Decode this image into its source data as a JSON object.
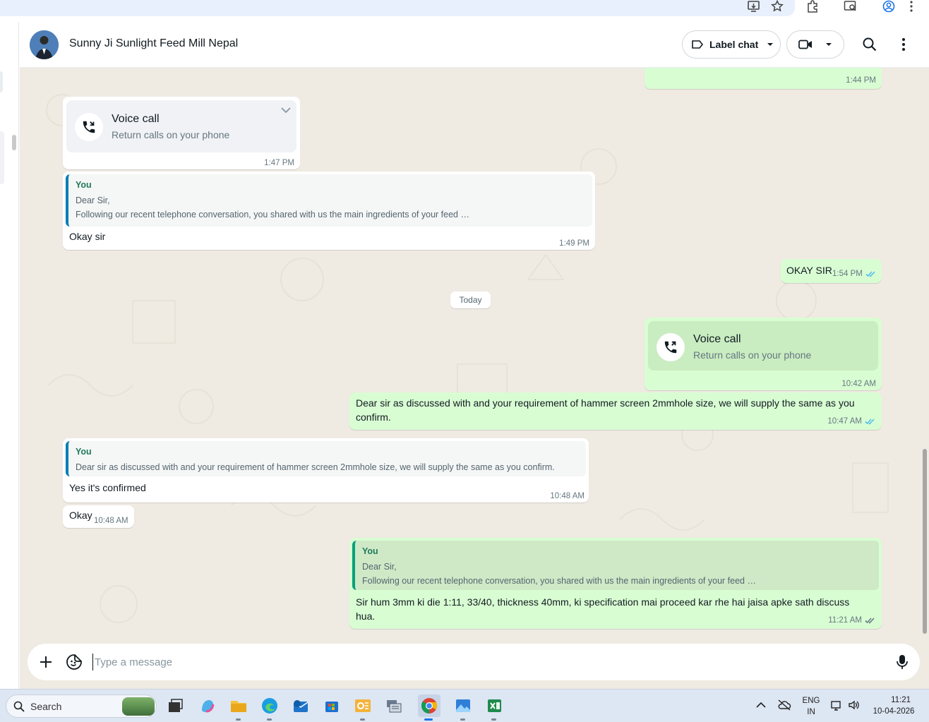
{
  "header": {
    "contact_name": "Sunny Ji Sunlight Feed Mill Nepal",
    "label_chat": "Label chat"
  },
  "messages": {
    "m0_time": "1:44 PM",
    "m1": {
      "title": "Voice call",
      "subtitle": "Return calls on your phone",
      "time": "1:47 PM"
    },
    "m2": {
      "quote_author": "You",
      "quote_line1": "Dear Sir,",
      "quote_line2": "Following our recent telephone conversation, you  shared with us the main ingredients of your feed …",
      "text": "Okay sir",
      "time": "1:49 PM"
    },
    "m3": {
      "text": "OKAY SIR",
      "time": "1:54 PM"
    },
    "date_divider": "Today",
    "m4": {
      "title": "Voice call",
      "subtitle": "Return calls on your phone",
      "time": "10:42 AM"
    },
    "m5": {
      "text_line1": "Dear sir as discussed with and your requirement of hammer screen 2mmhole size, we will supply the same as you",
      "text_line2": "confirm.",
      "time": "10:47 AM"
    },
    "m6": {
      "quote_author": "You",
      "quote_line1": "Dear sir as discussed with and your requirement of hammer screen 2mmhole size, we will supply the same as you confirm.",
      "text": "Yes it's confirmed",
      "time": "10:48 AM"
    },
    "m7": {
      "text": "Okay",
      "time": "10:48 AM"
    },
    "m8": {
      "quote_author": "You",
      "quote_line1": "Dear Sir,",
      "quote_line2": "Following our recent telephone conversation, you  shared with us the main ingredients of your feed …",
      "text_line1": "Sir hum 3mm ki die 1:11, 33/40, thickness 40mm, ki specification mai proceed kar rhe hai jaisa apke sath  discuss",
      "text_line2": "hua.",
      "time": "11:21 AM"
    }
  },
  "compose": {
    "placeholder": "Type a message"
  },
  "taskbar": {
    "search_label": "Search",
    "lang_top": "ENG",
    "lang_bottom": "IN",
    "clock_time": "11:21",
    "clock_date": "10-04-2026"
  },
  "colors": {
    "outgoing": "#d9fdd3",
    "incoming": "#ffffff",
    "wallpaper": "#efeae2",
    "tick_blue": "#53bdeb"
  }
}
